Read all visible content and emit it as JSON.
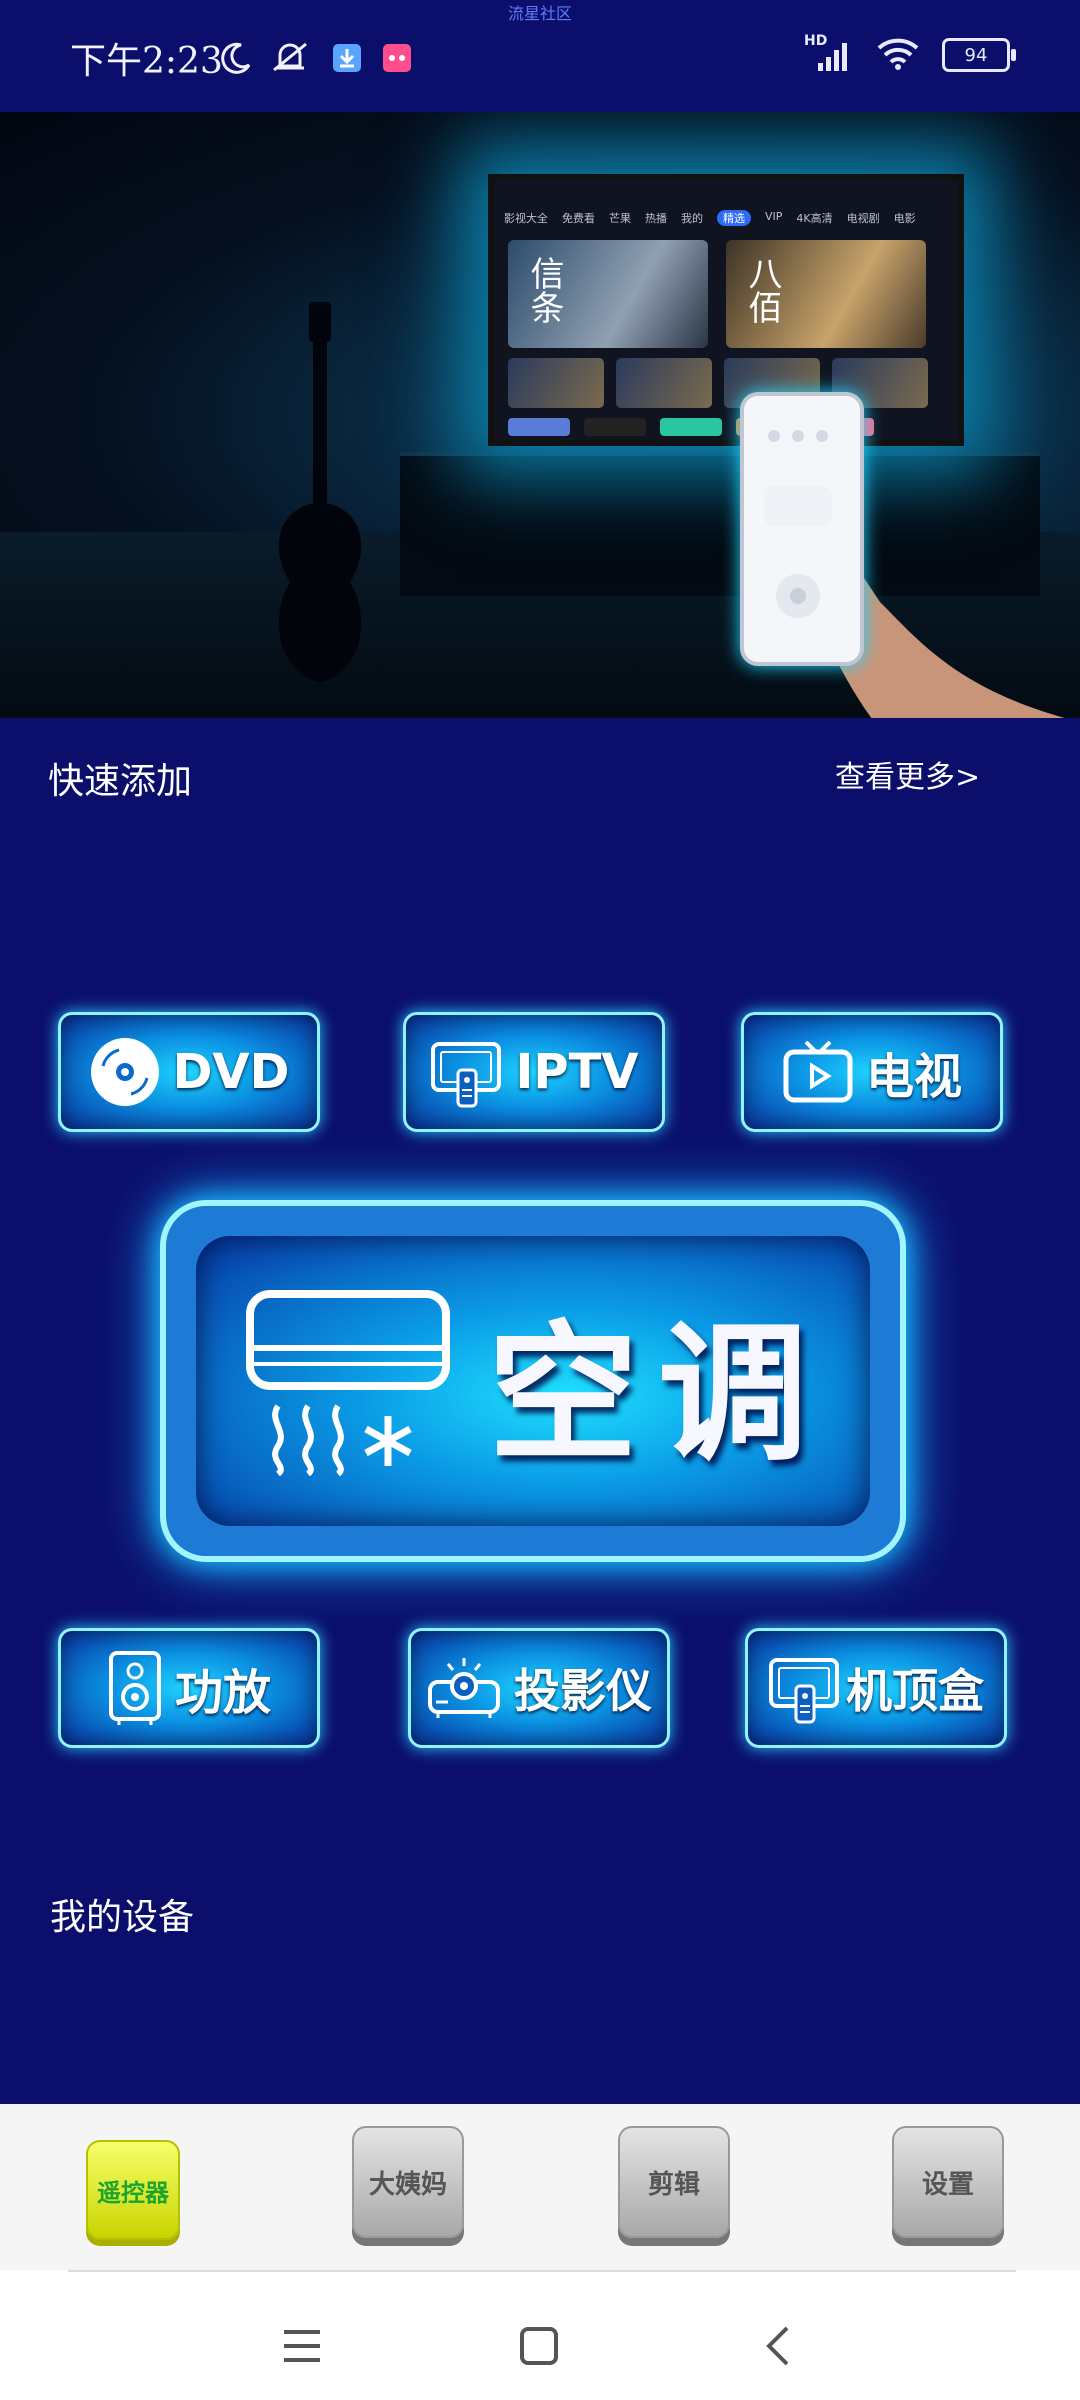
{
  "status_bar": {
    "watermark": "流星社区",
    "time": "下午2:23",
    "network": "HD",
    "battery": "94",
    "icons": [
      "moon-icon",
      "bell-off-icon",
      "download-icon",
      "app-icon",
      "signal-icon",
      "wifi-icon",
      "battery-icon"
    ]
  },
  "banner": {
    "tv_tabs": [
      "影视大全",
      "免费看",
      "芒果",
      "热播",
      "我的",
      "精选",
      "VIP",
      "4K高清",
      "电视剧",
      "电影"
    ],
    "poster_1": "信条",
    "poster_2": "八佰"
  },
  "quick_add": {
    "title": "快速添加",
    "more": "查看更多>",
    "buttons": [
      {
        "label": "DVD",
        "icon": "dvd-disc-icon"
      },
      {
        "label": "IPTV",
        "icon": "iptv-remote-icon"
      },
      {
        "label": "电视",
        "icon": "tv-icon"
      }
    ],
    "big_button": {
      "label": "空调",
      "icon": "air-conditioner-icon"
    },
    "buttons_row2": [
      {
        "label": "功放",
        "icon": "speaker-icon"
      },
      {
        "label": "投影仪",
        "icon": "projector-icon"
      },
      {
        "label": "机顶盒",
        "icon": "settop-box-icon"
      }
    ]
  },
  "my_devices": {
    "title": "我的设备"
  },
  "tabbar": {
    "tabs": [
      {
        "label": "遥控器",
        "active": true
      },
      {
        "label": "大姨妈",
        "active": false
      },
      {
        "label": "剪辑",
        "active": false
      },
      {
        "label": "设置",
        "active": false
      }
    ]
  },
  "colors": {
    "background": "#0b0f6b",
    "neon": "#1fd3ff",
    "tab_active": "#f7ff6a"
  }
}
